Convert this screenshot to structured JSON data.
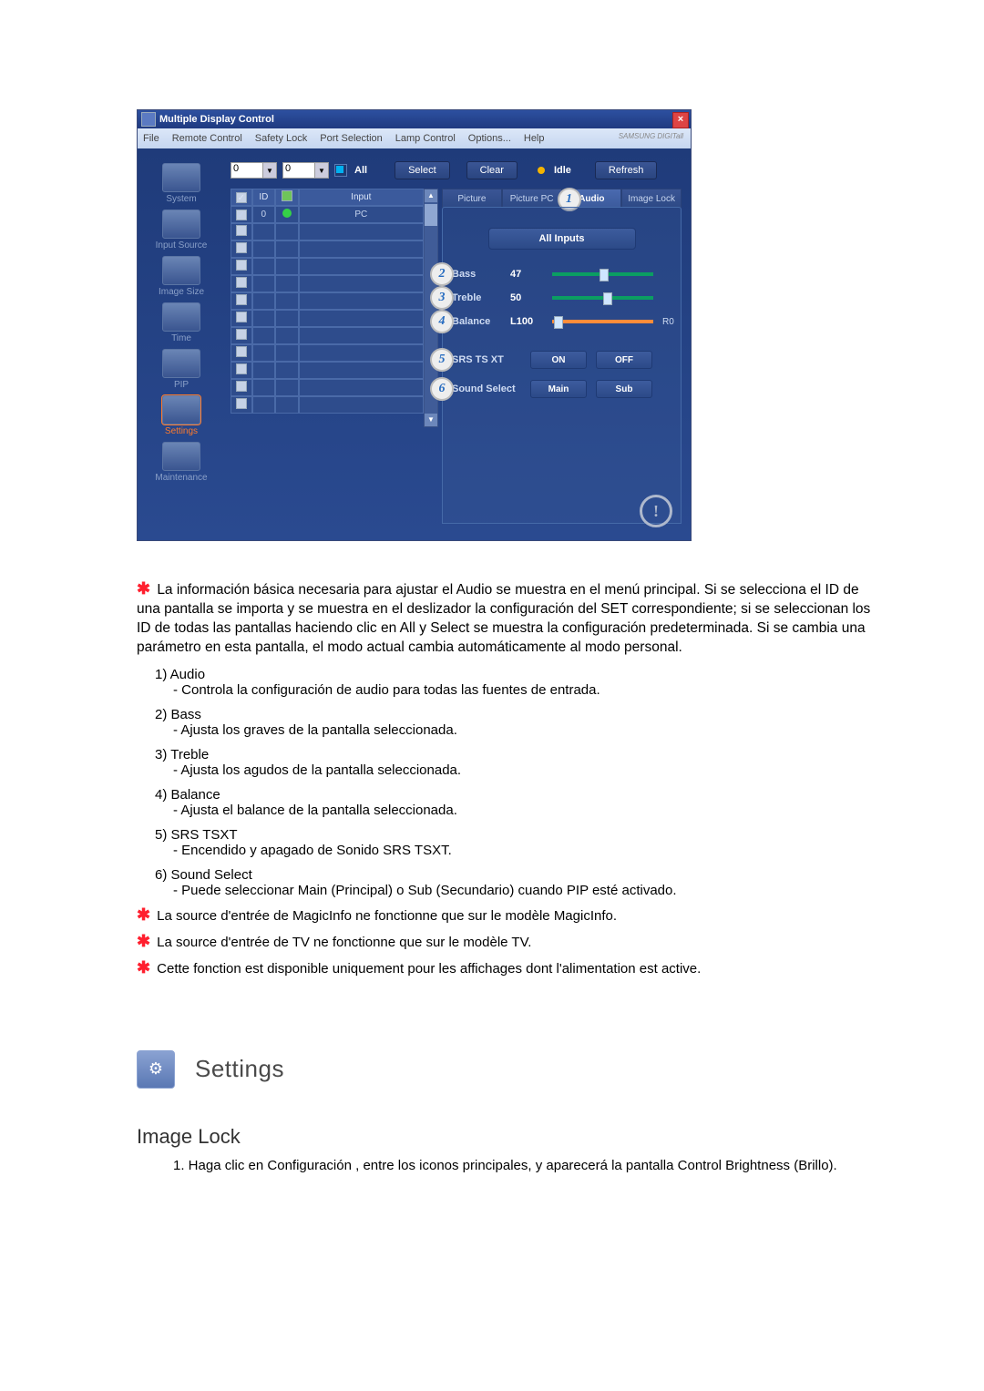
{
  "window": {
    "title": "Multiple Display Control",
    "menu": [
      "File",
      "Remote Control",
      "Safety Lock",
      "Port Selection",
      "Lamp Control",
      "Options...",
      "Help"
    ],
    "brand": "SAMSUNG DIGITall"
  },
  "sidebar": [
    {
      "label": "System"
    },
    {
      "label": "Input Source"
    },
    {
      "label": "Image Size"
    },
    {
      "label": "Time"
    },
    {
      "label": "PIP"
    },
    {
      "label": "Settings",
      "active": true
    },
    {
      "label": "Maintenance"
    }
  ],
  "toolbar": {
    "combo1": "0",
    "combo2": "0",
    "all": "All",
    "select": "Select",
    "clear": "Clear",
    "idle": "Idle",
    "refresh": "Refresh"
  },
  "grid": {
    "headers": [
      "",
      "ID",
      "",
      "Input"
    ],
    "rows": [
      [
        "on",
        "0",
        "dot",
        "PC"
      ],
      [
        "",
        "",
        "",
        ""
      ],
      [
        "",
        "",
        "",
        ""
      ],
      [
        "",
        "",
        "",
        ""
      ],
      [
        "",
        "",
        "",
        ""
      ],
      [
        "",
        "",
        "",
        ""
      ],
      [
        "",
        "",
        "",
        ""
      ],
      [
        "",
        "",
        "",
        ""
      ],
      [
        "",
        "",
        "",
        ""
      ],
      [
        "",
        "",
        "",
        ""
      ],
      [
        "",
        "",
        "",
        ""
      ],
      [
        "",
        "",
        "",
        ""
      ]
    ]
  },
  "tabs": [
    "Picture",
    "Picture PC",
    "Audio",
    "Image Lock"
  ],
  "panel": {
    "allInputs": "All Inputs",
    "sliders": [
      {
        "n": "2",
        "label": "Bass",
        "val": "47",
        "pos": 47,
        "type": "g"
      },
      {
        "n": "3",
        "label": "Treble",
        "val": "50",
        "pos": 50,
        "type": "g"
      },
      {
        "n": "4",
        "label": "Balance",
        "val": "L100",
        "pos": 2,
        "type": "b",
        "right": "R0"
      }
    ],
    "btnRows": [
      {
        "n": "5",
        "label": "SRS TS XT",
        "a": "ON",
        "b": "OFF"
      },
      {
        "n": "6",
        "label": "Sound Select",
        "a": "Main",
        "b": "Sub"
      }
    ]
  },
  "text": {
    "intro": "La información básica necesaria para ajustar el Audio se muestra en el menú principal. Si se selecciona el ID de una pantalla se importa y se muestra en el deslizador la configuración del SET correspondiente; si se seleccionan los ID de todas las pantallas haciendo clic en All y Select se muestra la configuración predeterminada. Si se cambia una parámetro en esta pantalla, el modo actual cambia automáticamente al modo personal.",
    "items": [
      {
        "t": "1)  Audio",
        "d": "- Controla la configuración de audio para todas las fuentes de entrada."
      },
      {
        "t": "2)  Bass",
        "d": "- Ajusta los graves de la pantalla seleccionada."
      },
      {
        "t": "3)  Treble",
        "d": "- Ajusta los agudos de la pantalla seleccionada."
      },
      {
        "t": "4)  Balance",
        "d": "- Ajusta el balance de la pantalla seleccionada."
      },
      {
        "t": "5)  SRS TSXT",
        "d": "- Encendido y apagado de Sonido SRS TSXT."
      },
      {
        "t": "6)  Sound Select",
        "d": "- Puede seleccionar Main (Principal) o Sub (Secundario) cuando PIP esté activado."
      }
    ],
    "notes": [
      "La source d'entrée de MagicInfo ne fonctionne que sur le modèle MagicInfo.",
      "La source d'entrée de TV ne fonctionne que sur le modèle TV.",
      "Cette fonction est disponible uniquement pour les affichages dont l'alimentation est active."
    ],
    "sectionTitle": "Settings",
    "subTitle": "Image Lock",
    "subStep": "1.  Haga clic en Configuración , entre los iconos principales, y aparecerá la pantalla Control Brightness (Brillo)."
  }
}
